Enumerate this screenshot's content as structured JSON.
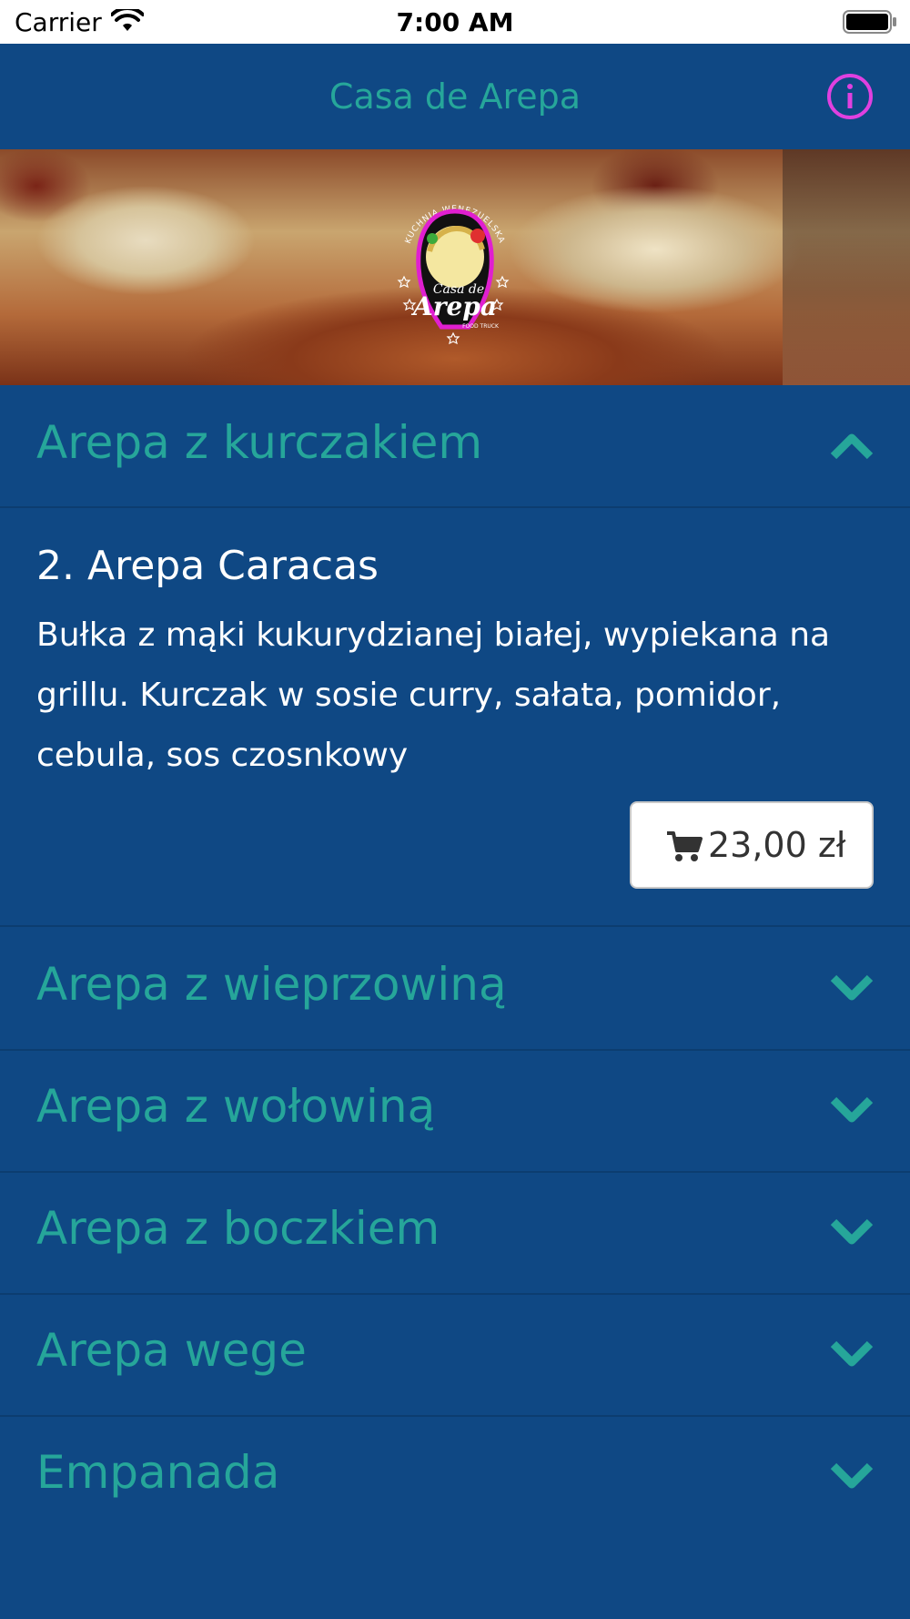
{
  "status_bar": {
    "carrier": "Carrier",
    "time": "7:00 AM"
  },
  "nav": {
    "title": "Casa de Arepa",
    "info_icon": "info-icon"
  },
  "hero": {
    "logo_top_text": "KUCHNIA WENEZUELSKA",
    "logo_main_small": "Casa de",
    "logo_main_big": "Arepa",
    "logo_sub": "FOOD TRUCK"
  },
  "menu": {
    "expanded_section": {
      "title": "Arepa z kurczakiem",
      "item": {
        "name": "2. Arepa Caracas",
        "description": "Bułka z mąki kukurydzianej białej, wypiekana na grillu. Kurczak w sosie curry, sałata, pomidor, cebula, sos czosnkowy",
        "price": "23,00 zł"
      }
    },
    "sections": [
      {
        "title": "Arepa z wieprzowiną"
      },
      {
        "title": "Arepa z wołowiną"
      },
      {
        "title": "Arepa z boczkiem"
      },
      {
        "title": "Arepa wege"
      },
      {
        "title": "Empanada"
      }
    ]
  },
  "colors": {
    "background": "#0f4884",
    "accent": "#26a69a",
    "info": "#e040e0"
  }
}
